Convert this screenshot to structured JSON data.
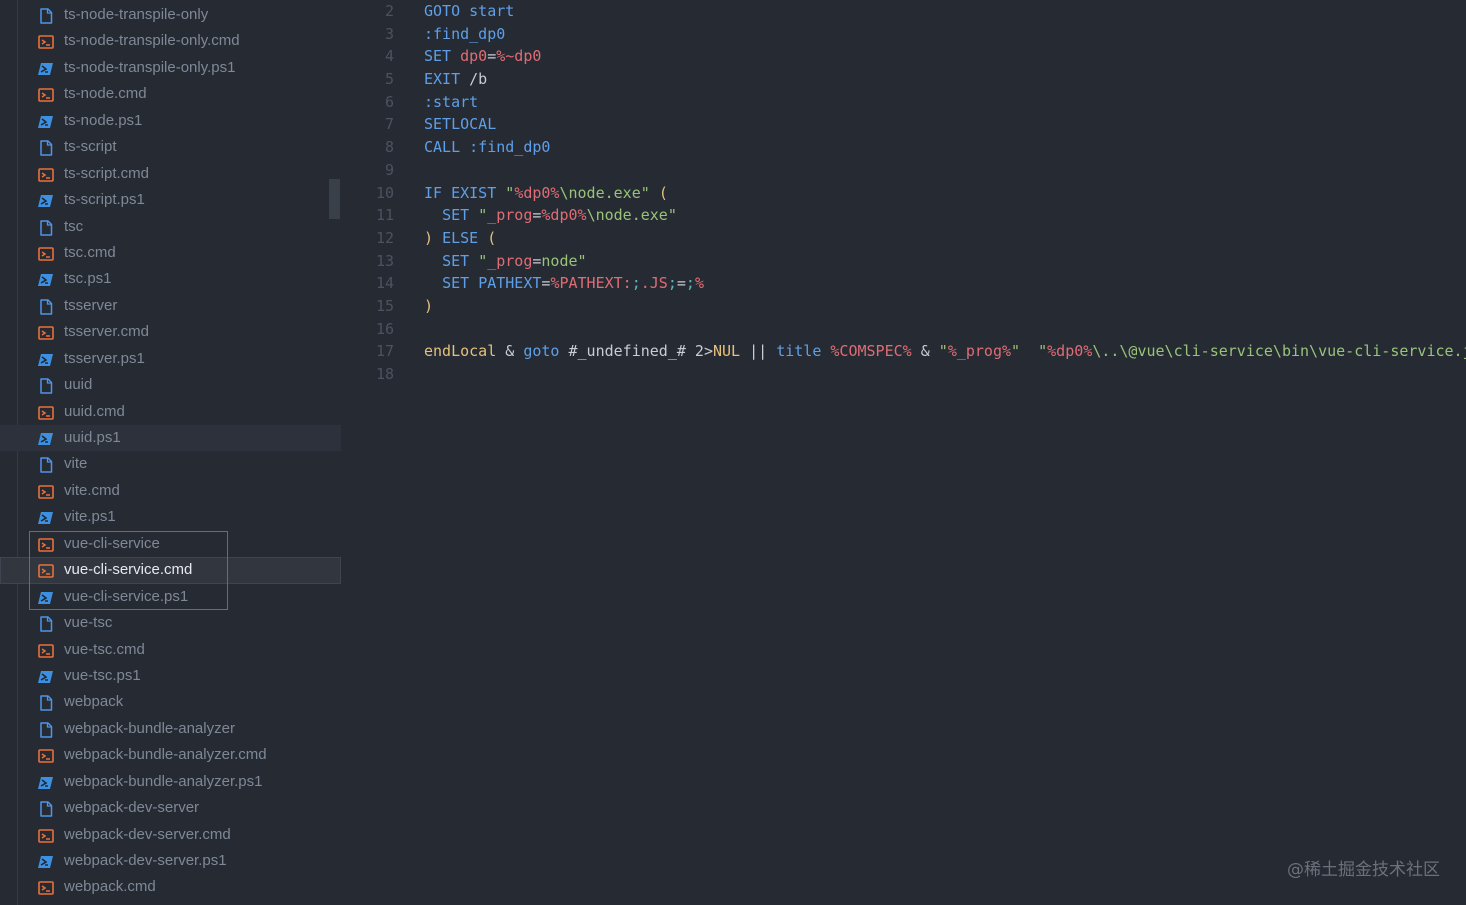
{
  "sidebar": {
    "files": [
      {
        "label": "ts-node-transpile-only",
        "icon": "file-icon"
      },
      {
        "label": "ts-node-transpile-only.cmd",
        "icon": "cmd-icon"
      },
      {
        "label": "ts-node-transpile-only.ps1",
        "icon": "powershell-icon"
      },
      {
        "label": "ts-node.cmd",
        "icon": "cmd-icon"
      },
      {
        "label": "ts-node.ps1",
        "icon": "powershell-icon"
      },
      {
        "label": "ts-script",
        "icon": "file-icon"
      },
      {
        "label": "ts-script.cmd",
        "icon": "cmd-icon"
      },
      {
        "label": "ts-script.ps1",
        "icon": "powershell-icon"
      },
      {
        "label": "tsc",
        "icon": "file-icon"
      },
      {
        "label": "tsc.cmd",
        "icon": "cmd-icon"
      },
      {
        "label": "tsc.ps1",
        "icon": "powershell-icon"
      },
      {
        "label": "tsserver",
        "icon": "file-icon"
      },
      {
        "label": "tsserver.cmd",
        "icon": "cmd-icon"
      },
      {
        "label": "tsserver.ps1",
        "icon": "powershell-icon"
      },
      {
        "label": "uuid",
        "icon": "file-icon"
      },
      {
        "label": "uuid.cmd",
        "icon": "cmd-icon"
      },
      {
        "label": "uuid.ps1",
        "icon": "powershell-icon"
      },
      {
        "label": "vite",
        "icon": "file-icon"
      },
      {
        "label": "vite.cmd",
        "icon": "cmd-icon"
      },
      {
        "label": "vite.ps1",
        "icon": "powershell-icon"
      },
      {
        "label": "vue-cli-service",
        "icon": "cmd-icon"
      },
      {
        "label": "vue-cli-service.cmd",
        "icon": "cmd-icon"
      },
      {
        "label": "vue-cli-service.ps1",
        "icon": "powershell-icon"
      },
      {
        "label": "vue-tsc",
        "icon": "file-icon"
      },
      {
        "label": "vue-tsc.cmd",
        "icon": "cmd-icon"
      },
      {
        "label": "vue-tsc.ps1",
        "icon": "powershell-icon"
      },
      {
        "label": "webpack",
        "icon": "file-icon"
      },
      {
        "label": "webpack-bundle-analyzer",
        "icon": "file-icon"
      },
      {
        "label": "webpack-bundle-analyzer.cmd",
        "icon": "cmd-icon"
      },
      {
        "label": "webpack-bundle-analyzer.ps1",
        "icon": "powershell-icon"
      },
      {
        "label": "webpack-dev-server",
        "icon": "file-icon"
      },
      {
        "label": "webpack-dev-server.cmd",
        "icon": "cmd-icon"
      },
      {
        "label": "webpack-dev-server.ps1",
        "icon": "powershell-icon"
      },
      {
        "label": "webpack.cmd",
        "icon": "cmd-icon"
      }
    ],
    "selected_file": "vue-cli-service.cmd",
    "hovered_file": "uuid.ps1",
    "highlighted_files": [
      "vue-cli-service",
      "vue-cli-service.cmd",
      "vue-cli-service.ps1"
    ]
  },
  "editor": {
    "lines": [
      {
        "num": "2",
        "tokens": [
          [
            "kw",
            "GOTO"
          ],
          [
            "def",
            " "
          ],
          [
            "fn",
            "start"
          ]
        ]
      },
      {
        "num": "3",
        "tokens": [
          [
            "fn",
            ":find_dp0"
          ]
        ]
      },
      {
        "num": "4",
        "tokens": [
          [
            "kw",
            "SET"
          ],
          [
            "def",
            " "
          ],
          [
            "var",
            "dp0"
          ],
          [
            "op",
            "="
          ],
          [
            "var",
            "%~dp0"
          ]
        ]
      },
      {
        "num": "5",
        "tokens": [
          [
            "kw",
            "EXIT"
          ],
          [
            "def",
            " /b"
          ]
        ]
      },
      {
        "num": "6",
        "tokens": [
          [
            "fn",
            ":start"
          ]
        ]
      },
      {
        "num": "7",
        "tokens": [
          [
            "kw",
            "SETLOCAL"
          ]
        ]
      },
      {
        "num": "8",
        "tokens": [
          [
            "kw",
            "CALL"
          ],
          [
            "def",
            " "
          ],
          [
            "fn",
            ":find_dp0"
          ]
        ]
      },
      {
        "num": "9",
        "tokens": []
      },
      {
        "num": "10",
        "tokens": [
          [
            "kw",
            "IF"
          ],
          [
            "def",
            " "
          ],
          [
            "kw",
            "EXIST"
          ],
          [
            "def",
            " "
          ],
          [
            "str",
            "\""
          ],
          [
            "var",
            "%dp0%"
          ],
          [
            "str",
            "\\node.exe\""
          ],
          [
            "def",
            " "
          ],
          [
            "br",
            "("
          ]
        ]
      },
      {
        "num": "11",
        "tokens": [
          [
            "def",
            "  "
          ],
          [
            "kw",
            "SET"
          ],
          [
            "def",
            " "
          ],
          [
            "str",
            "\""
          ],
          [
            "var",
            "_prog"
          ],
          [
            "op",
            "="
          ],
          [
            "var",
            "%dp0%"
          ],
          [
            "str",
            "\\node.exe\""
          ]
        ]
      },
      {
        "num": "12",
        "tokens": [
          [
            "br",
            ")"
          ],
          [
            "def",
            " "
          ],
          [
            "kw",
            "ELSE"
          ],
          [
            "def",
            " "
          ],
          [
            "br",
            "("
          ]
        ]
      },
      {
        "num": "13",
        "tokens": [
          [
            "def",
            "  "
          ],
          [
            "kw",
            "SET"
          ],
          [
            "def",
            " "
          ],
          [
            "str",
            "\""
          ],
          [
            "var",
            "_prog"
          ],
          [
            "op",
            "="
          ],
          [
            "str",
            "node\""
          ]
        ]
      },
      {
        "num": "14",
        "tokens": [
          [
            "def",
            "  "
          ],
          [
            "kw",
            "SET"
          ],
          [
            "def",
            " "
          ],
          [
            "kw",
            "PATHEXT"
          ],
          [
            "op",
            "="
          ],
          [
            "var",
            "%PATHEXT:"
          ],
          [
            "cy",
            ";"
          ],
          [
            "var",
            ".JS"
          ],
          [
            "cy",
            ";"
          ],
          [
            "op",
            "="
          ],
          [
            "cy",
            ";"
          ],
          [
            "var",
            "%"
          ]
        ]
      },
      {
        "num": "15",
        "tokens": [
          [
            "br",
            ")"
          ]
        ]
      },
      {
        "num": "16",
        "tokens": []
      },
      {
        "num": "17",
        "tokens": [
          [
            "yel",
            "endLocal"
          ],
          [
            "def",
            " & "
          ],
          [
            "fn",
            "goto"
          ],
          [
            "def",
            " #_undefined_# 2>"
          ],
          [
            "yel",
            "NUL"
          ],
          [
            "def",
            " || "
          ],
          [
            "fn",
            "title"
          ],
          [
            "def",
            " "
          ],
          [
            "var",
            "%COMSPEC%"
          ],
          [
            "def",
            " & "
          ],
          [
            "str",
            "\""
          ],
          [
            "var",
            "%_prog%"
          ],
          [
            "str",
            "\""
          ],
          [
            "def",
            "  "
          ],
          [
            "str",
            "\""
          ],
          [
            "var",
            "%dp0%"
          ],
          [
            "str",
            "\\..\\@vue\\cli-service\\bin\\vue-cli-service.js\""
          ]
        ]
      },
      {
        "num": "18",
        "tokens": []
      }
    ]
  },
  "watermark": "@稀土掘金技术社区",
  "colors": {
    "background": "#262b33",
    "highlight_border": "#e23a3a",
    "cmd_icon": "#e8703a",
    "powershell_icon": "#3d8fe0",
    "file_icon": "#4f94e6"
  }
}
